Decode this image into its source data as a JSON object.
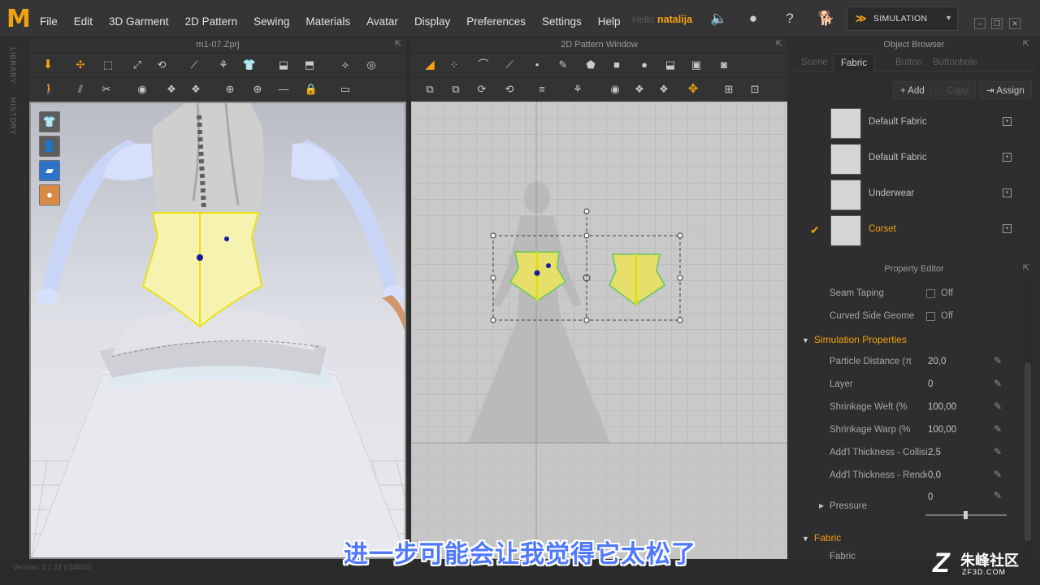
{
  "menubar": {
    "logo": "M",
    "items": [
      "File",
      "Edit",
      "3D Garment",
      "2D Pattern",
      "Sewing",
      "Materials",
      "Avatar",
      "Display",
      "Preferences",
      "Settings",
      "Help"
    ],
    "greeting": "Hello",
    "username": "natalija",
    "mode": "SIMULATION"
  },
  "siderail": {
    "library": "LIBRARY",
    "history": "HISTORY"
  },
  "viewport3d": {
    "title": "m1-07.Zprj"
  },
  "viewport2d": {
    "title": "2D Pattern Window"
  },
  "object_browser": {
    "title": "Object Browser",
    "tabs": [
      "Scene",
      "Fabric",
      "Button",
      "Buttonhole"
    ],
    "active_tab": "Fabric",
    "buttons": {
      "add": "Add",
      "copy": "Copy",
      "assign": "Assign"
    },
    "fabrics": [
      {
        "name": "Default Fabric",
        "selected": false
      },
      {
        "name": "Default Fabric",
        "selected": false
      },
      {
        "name": "Underwear",
        "selected": false
      },
      {
        "name": "Corset",
        "selected": true
      }
    ]
  },
  "property_editor": {
    "title": "Property Editor",
    "seam_taping": {
      "label": "Seam Taping",
      "value": "Off"
    },
    "curved_side": {
      "label": "Curved Side Geome",
      "value": "Off"
    },
    "sim_section": "Simulation Properties",
    "props": [
      {
        "label": "Particle Distance (π",
        "value": "20,0"
      },
      {
        "label": "Layer",
        "value": "0"
      },
      {
        "label": "Shrinkage Weft (%",
        "value": "100,00"
      },
      {
        "label": "Shrinkage Warp (%",
        "value": "100,00"
      },
      {
        "label": "Add'l Thickness - Collisic",
        "value": "2,5"
      },
      {
        "label": "Add'l Thickness - Render",
        "value": "0,0"
      }
    ],
    "pressure": {
      "label": "Pressure",
      "value": "0"
    },
    "fabric_section": "Fabric",
    "fabric_row_label": "Fabric"
  },
  "status": {
    "version": "Version: 3.1.22     (r24655)"
  },
  "subtitle": "进一步可能会让我觉得它太松了",
  "watermark": {
    "main": "朱峰社区",
    "sub": "ZF3D.COM",
    "mark": "Z"
  },
  "colors": {
    "accent": "#f3a20f",
    "corset_fill": "#f6f2b0",
    "corset_edge": "#e8e01a",
    "subtitle": "#4f78ff"
  }
}
